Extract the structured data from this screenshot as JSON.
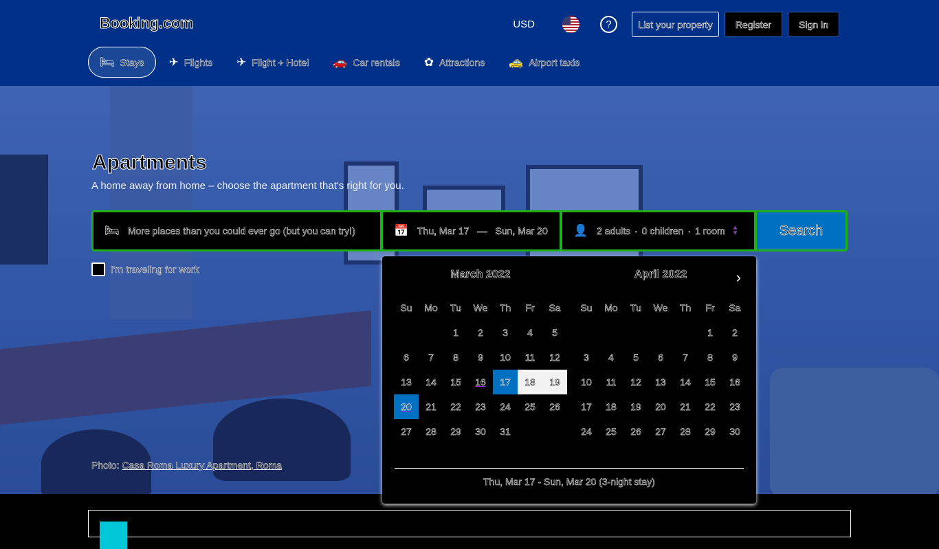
{
  "header": {
    "logo": "Booking.com",
    "currency": "USD",
    "flag_icon": "us-flag-icon",
    "help_icon": "?",
    "list_property": "List your property",
    "register": "Register",
    "sign_in": "Sign in"
  },
  "nav": {
    "items": [
      {
        "label": "Stays",
        "icon": "🛏",
        "active": true
      },
      {
        "label": "Flights",
        "icon": "✈",
        "active": false
      },
      {
        "label": "Flight + Hotel",
        "icon": "✈",
        "active": false
      },
      {
        "label": "Car rentals",
        "icon": "🚗",
        "active": false
      },
      {
        "label": "Attractions",
        "icon": "✿",
        "active": false
      },
      {
        "label": "Airport taxis",
        "icon": "🚕",
        "active": false
      }
    ]
  },
  "hero": {
    "title": "Apartments",
    "subtitle": "A home away from home – choose the apartment that's right for you.",
    "photo_prefix": "Photo: ",
    "photo_link": "Casa Roma Luxury Apartment, Roma"
  },
  "search": {
    "destination_placeholder": "More places than you could ever go (but you can try!)",
    "checkin": "Thu, Mar 17",
    "date_dash": "—",
    "checkout": "Sun, Mar 20",
    "adults": "2 adults",
    "children": "0 children",
    "rooms": "1 room",
    "dot": "·",
    "button": "Search",
    "work_label": "I'm traveling for work"
  },
  "calendar": {
    "months": [
      {
        "title": "March 2022",
        "weekdays": [
          "Su",
          "Mo",
          "Tu",
          "We",
          "Th",
          "Fr",
          "Sa"
        ],
        "leading_blanks": 2,
        "days": [
          "1",
          "2",
          "3",
          "4",
          "5",
          "6",
          "7",
          "8",
          "9",
          "10",
          "11",
          "12",
          "13",
          "14",
          "15",
          "16",
          "17",
          "18",
          "19",
          "20",
          "21",
          "22",
          "23",
          "24",
          "25",
          "26",
          "27",
          "28",
          "29",
          "30",
          "31"
        ],
        "selected": [
          "17",
          "20"
        ],
        "in_range": [
          "18",
          "19"
        ],
        "underlined": [
          "16",
          "20"
        ]
      },
      {
        "title": "April 2022",
        "weekdays": [
          "Su",
          "Mo",
          "Tu",
          "We",
          "Th",
          "Fr",
          "Sa"
        ],
        "leading_blanks": 5,
        "days": [
          "1",
          "2",
          "3",
          "4",
          "5",
          "6",
          "7",
          "8",
          "9",
          "10",
          "11",
          "12",
          "13",
          "14",
          "15",
          "16",
          "17",
          "18",
          "19",
          "20",
          "21",
          "22",
          "23",
          "24",
          "25",
          "26",
          "27",
          "28",
          "29",
          "30"
        ],
        "selected": [],
        "in_range": [],
        "underlined": []
      }
    ],
    "next_icon": "›",
    "footer": "Thu, Mar 17 - Sun, Mar 20 (3-night stay)"
  },
  "colors": {
    "header_bg": "#003087",
    "search_border": "#1db019",
    "accent_blue": "#0071c2"
  }
}
